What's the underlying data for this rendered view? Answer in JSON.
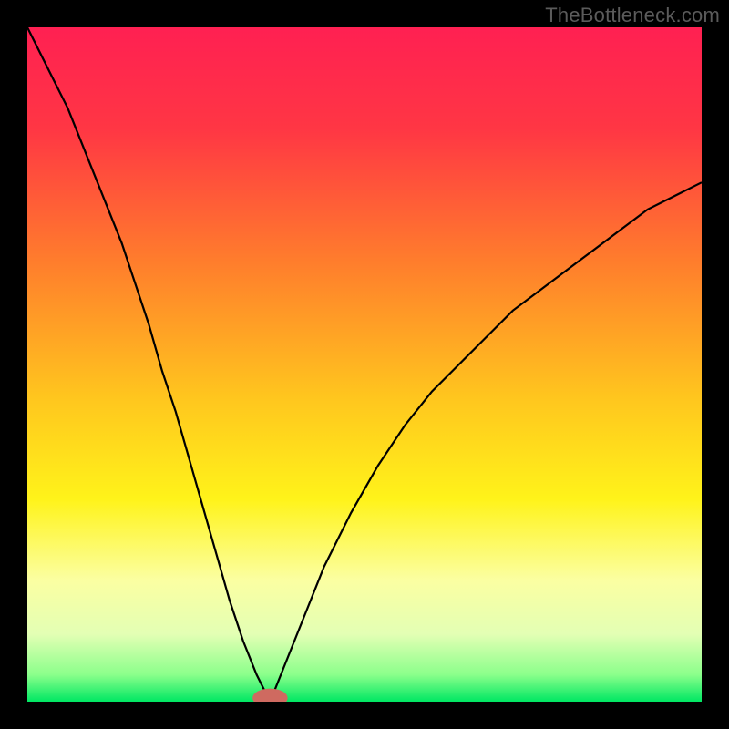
{
  "watermark": "TheBottleneck.com",
  "colors": {
    "frame": "#000000",
    "curve": "#000000",
    "marker_fill": "#cf6a60",
    "gradient_stops": [
      {
        "offset": 0.0,
        "color": "#ff2052"
      },
      {
        "offset": 0.15,
        "color": "#ff3644"
      },
      {
        "offset": 0.35,
        "color": "#ff7e2c"
      },
      {
        "offset": 0.55,
        "color": "#ffc61e"
      },
      {
        "offset": 0.7,
        "color": "#fff31a"
      },
      {
        "offset": 0.82,
        "color": "#fbffa2"
      },
      {
        "offset": 0.9,
        "color": "#e3ffb4"
      },
      {
        "offset": 0.96,
        "color": "#8bff8b"
      },
      {
        "offset": 1.0,
        "color": "#00e763"
      }
    ]
  },
  "chart_data": {
    "type": "line",
    "title": "",
    "xlabel": "",
    "ylabel": "",
    "xlim": [
      0,
      100
    ],
    "ylim": [
      0,
      100
    ],
    "legend": false,
    "grid": false,
    "axes_visible": false,
    "notch_x": 36,
    "marker": {
      "x": 36,
      "y": 0,
      "rx": 2.6,
      "ry": 1.0
    },
    "series": [
      {
        "name": "left-branch",
        "x": [
          0,
          2,
          4,
          6,
          8,
          10,
          12,
          14,
          16,
          18,
          20,
          22,
          24,
          26,
          28,
          30,
          32,
          34,
          36
        ],
        "y": [
          100,
          96,
          92,
          88,
          83,
          78,
          73,
          68,
          62,
          56,
          49,
          43,
          36,
          29,
          22,
          15,
          9,
          4,
          0
        ]
      },
      {
        "name": "right-branch",
        "x": [
          36,
          38,
          40,
          42,
          44,
          46,
          48,
          52,
          56,
          60,
          64,
          68,
          72,
          76,
          80,
          84,
          88,
          92,
          96,
          100
        ],
        "y": [
          0,
          5,
          10,
          15,
          20,
          24,
          28,
          35,
          41,
          46,
          50,
          54,
          58,
          61,
          64,
          67,
          70,
          73,
          75,
          77
        ]
      }
    ]
  }
}
